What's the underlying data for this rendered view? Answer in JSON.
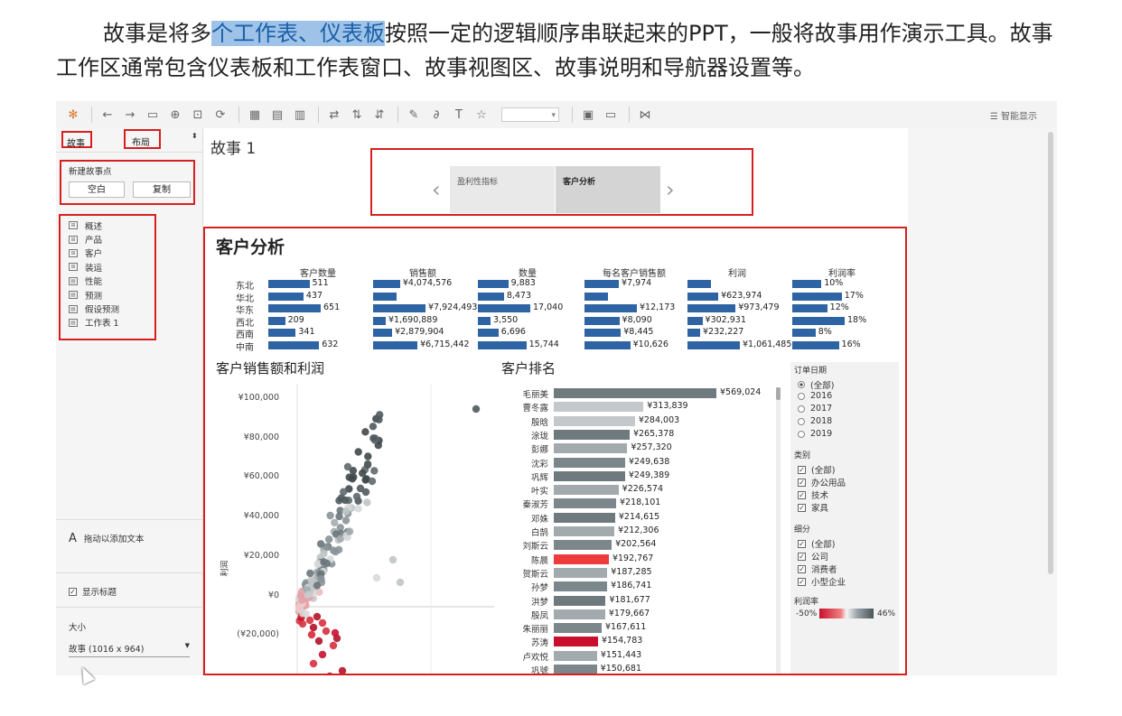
{
  "intro": {
    "text_before": "故事是将多",
    "text_highlight": "个工作表、仪表板",
    "text_after": "按照一定的逻辑顺序串联起来的PPT，一般将故事用作演示工具。故事工作区通常包含仪表板和工作表窗口、故事视图区、故事说明和导航器设置等。"
  },
  "toolbar": {
    "smart_show": "智能显示"
  },
  "left_panel": {
    "tab_story": "故事",
    "tab_layout": "布局",
    "new_point_label": "新建故事点",
    "blank_button": "空白",
    "copy_button": "复制",
    "sheets": [
      {
        "label": "概述",
        "type": "dashboard"
      },
      {
        "label": "产品",
        "type": "dashboard"
      },
      {
        "label": "客户",
        "type": "dashboard"
      },
      {
        "label": "装运",
        "type": "dashboard"
      },
      {
        "label": "性能",
        "type": "sheet"
      },
      {
        "label": "预测",
        "type": "sheet"
      },
      {
        "label": "假设预测",
        "type": "sheet"
      },
      {
        "label": "工作表 1",
        "type": "sheet"
      }
    ],
    "drag_text": "拖动以添加文本",
    "show_title": "显示标题",
    "size_label": "大小",
    "size_value": "故事 (1016 x 964)"
  },
  "story": {
    "title": "故事 1",
    "points": [
      "盈利性指标",
      "客户分析"
    ],
    "active_point": 1
  },
  "dashboard": {
    "title": "客户分析",
    "columns": [
      "客户数量",
      "销售额",
      "数量",
      "每名客户销售额",
      "利润",
      "利润率"
    ],
    "regions": [
      "东北",
      "华北",
      "华东",
      "西北",
      "西南",
      "中南"
    ],
    "values": {
      "客户数量": [
        "511",
        "437",
        "651",
        "209",
        "341",
        "632"
      ],
      "销售额": [
        "¥4,074,576",
        "",
        "¥7,924,493",
        "¥1,690,889",
        "¥2,879,904",
        "¥6,715,442"
      ],
      "数量": [
        "9,883",
        "8,473",
        "17,040",
        "3,550",
        "6,696",
        "15,744"
      ],
      "每名客户销售额": [
        "¥7,974",
        "",
        "¥12,173",
        "¥8,090",
        "¥8,445",
        "¥10,626"
      ],
      "利润": [
        "",
        "¥623,974",
        "¥973,479",
        "¥302,931",
        "¥232,227",
        "¥1,061,485"
      ],
      "利润率": [
        "10%",
        "17%",
        "12%",
        "18%",
        "8%",
        "16%"
      ]
    },
    "scatter_title": "客户销售额和利润",
    "scatter_ylabel": "利润",
    "scatter_yticks": [
      "¥100,000",
      "¥80,000",
      "¥60,000",
      "¥40,000",
      "¥20,000",
      "¥0",
      "(¥20,000)"
    ],
    "ranking_title": "客户排名",
    "ranking": [
      {
        "name": "毛丽美",
        "value": "¥569,024"
      },
      {
        "name": "曹冬露",
        "value": "¥313,839"
      },
      {
        "name": "殷晗",
        "value": "¥284,003"
      },
      {
        "name": "涂珑",
        "value": "¥265,378"
      },
      {
        "name": "彭娜",
        "value": "¥257,320"
      },
      {
        "name": "沈彩",
        "value": "¥249,638"
      },
      {
        "name": "巩辉",
        "value": "¥249,389"
      },
      {
        "name": "叶实",
        "value": "¥226,574"
      },
      {
        "name": "秦淑芳",
        "value": "¥218,101"
      },
      {
        "name": "邓姝",
        "value": "¥214,615"
      },
      {
        "name": "白鹄",
        "value": "¥212,306"
      },
      {
        "name": "刘斯云",
        "value": "¥202,564"
      },
      {
        "name": "陈晨",
        "value": "¥192,767"
      },
      {
        "name": "贺斯云",
        "value": "¥187,285"
      },
      {
        "name": "孙梦",
        "value": "¥186,741"
      },
      {
        "name": "洪梦",
        "value": "¥181,677"
      },
      {
        "name": "殷凤",
        "value": "¥179,667"
      },
      {
        "name": "朱丽丽",
        "value": "¥167,611"
      },
      {
        "name": "苏涛",
        "value": "¥154,783"
      },
      {
        "name": "卢欢悦",
        "value": "¥151,443"
      },
      {
        "name": "巩號",
        "value": "¥150,681"
      }
    ],
    "filters": {
      "order_date_label": "订单日期",
      "order_date_options": [
        "(全部)",
        "2016",
        "2017",
        "2018",
        "2019"
      ],
      "category_label": "类别",
      "category_options": [
        "(全部)",
        "办公用品",
        "技术",
        "家具"
      ],
      "segment_label": "细分",
      "segment_options": [
        "(全部)",
        "公司",
        "消费者",
        "小型企业"
      ],
      "margin_label": "利润率",
      "margin_min": "-50%",
      "margin_max": "46%"
    }
  },
  "colors": {
    "accent_red": "#d62020",
    "bar_blue": "#2e64a3",
    "highlight": "#9fc3e8"
  }
}
